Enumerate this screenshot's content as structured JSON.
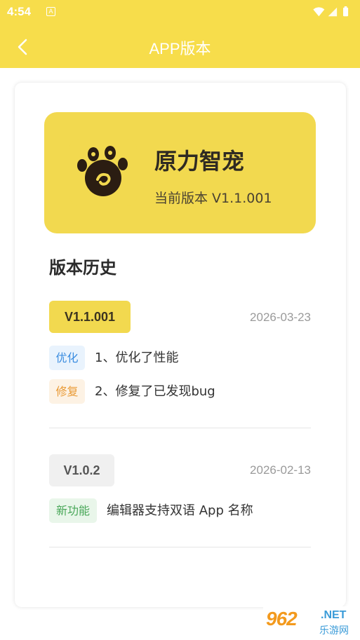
{
  "status_bar": {
    "time": "4:54",
    "notification_glyph": "A",
    "icons": [
      "wifi-icon",
      "signal-icon",
      "battery-icon"
    ]
  },
  "app_bar": {
    "title": "APP版本",
    "back_icon": "chevron-left-icon"
  },
  "app_info": {
    "name": "原力智宠",
    "current_version": "当前版本 V1.1.001",
    "logo_icon": "paw-logo-icon"
  },
  "history": {
    "title": "版本历史",
    "versions": [
      {
        "version": "V1.1.001",
        "date": "2026-03-23",
        "changes": [
          {
            "tag": "优化",
            "text": "1、优化了性能"
          },
          {
            "tag": "修复",
            "text": "2、修复了已发现bug"
          }
        ]
      },
      {
        "version": "V1.0.2",
        "date": "2026-02-13",
        "changes": [
          {
            "tag": "新功能",
            "text": "编辑器支持双语 App 名称"
          }
        ]
      }
    ]
  },
  "watermark": {
    "number": "962",
    "suffix": ".NET",
    "site": "乐游网"
  },
  "colors": {
    "brand_yellow": "#f7dd4b",
    "hero_yellow": "#f2d94f",
    "tag_blue": "#3b8de0",
    "tag_orange": "#e99a35",
    "tag_green": "#48a758"
  }
}
